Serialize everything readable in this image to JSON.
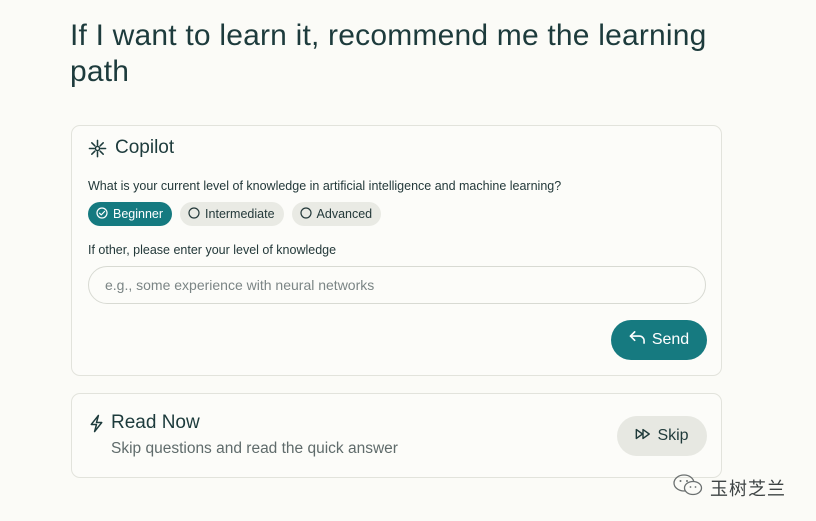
{
  "page": {
    "title": "If I want to learn it, recommend me the learning path"
  },
  "copilot": {
    "title": "Copilot",
    "icon": "sparkle-icon",
    "question": "What is your current level of knowledge in artificial intelligence and machine learning?",
    "options": [
      {
        "label": "Beginner",
        "selected": true
      },
      {
        "label": "Intermediate",
        "selected": false
      },
      {
        "label": "Advanced",
        "selected": false
      }
    ],
    "other_label": "If other, please enter your level of knowledge",
    "input": {
      "placeholder": "e.g., some experience with neural networks",
      "value": ""
    },
    "send_label": "Send"
  },
  "read_now": {
    "title": "Read Now",
    "icon": "lightning-icon",
    "subtitle": "Skip questions and read the quick answer",
    "skip_label": "Skip"
  },
  "watermark": {
    "text": "玉树芝兰"
  },
  "colors": {
    "accent": "#167a80",
    "background": "#fbfbf7",
    "chip_bg": "#e9eae4",
    "text": "#1d3b3c"
  }
}
